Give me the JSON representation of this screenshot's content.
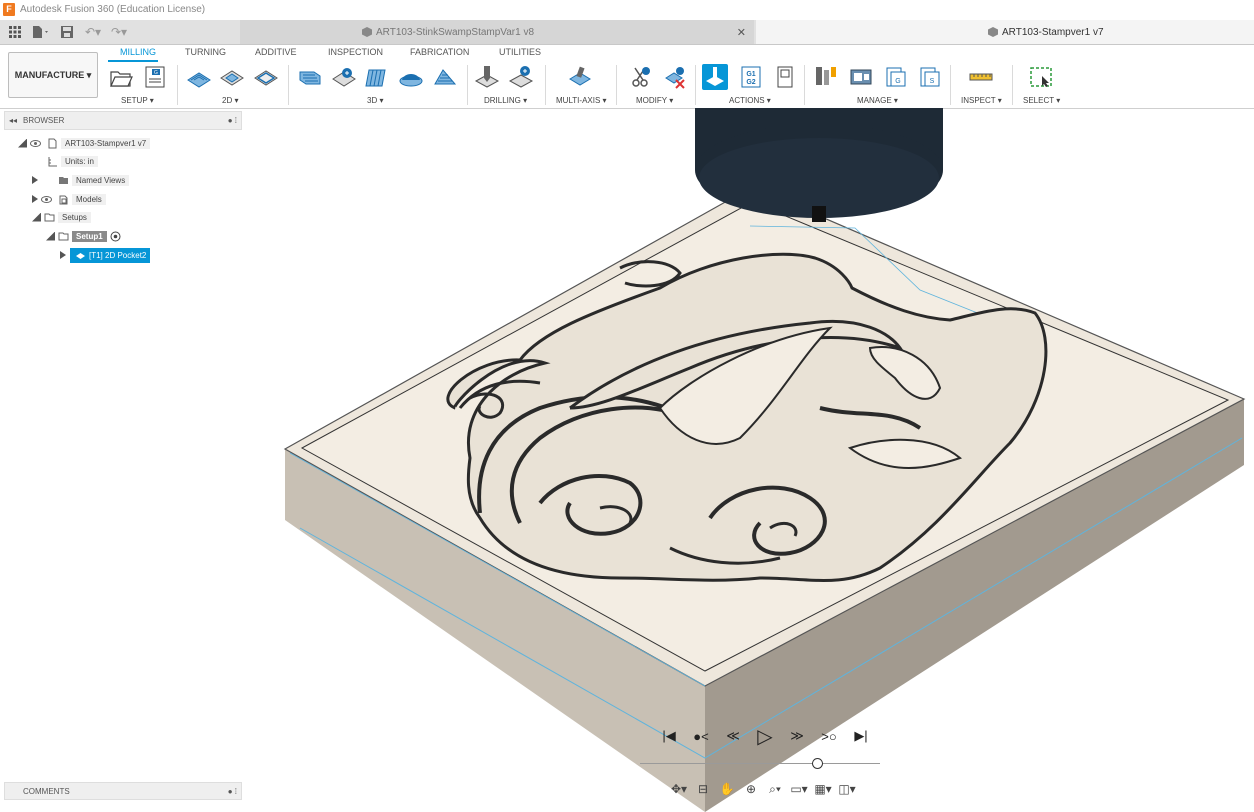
{
  "app": {
    "title": "Autodesk Fusion 360 (Education License)",
    "icon_letter": "F"
  },
  "doc_tabs": [
    {
      "label": "ART103-StinkSwampStampVar1 v8",
      "active": false
    },
    {
      "label": "ART103-Stampver1 v7",
      "active": true
    }
  ],
  "workspace": {
    "label": "MANUFACTURE ▾"
  },
  "ribbon_tabs": [
    "MILLING",
    "TURNING",
    "ADDITIVE",
    "INSPECTION",
    "FABRICATION",
    "UTILITIES"
  ],
  "ribbon_groups": [
    "SETUP ▾",
    "2D ▾",
    "3D ▾",
    "DRILLING ▾",
    "MULTI-AXIS ▾",
    "MODIFY ▾",
    "ACTIONS ▾",
    "MANAGE ▾",
    "INSPECT ▾",
    "SELECT ▾"
  ],
  "browser": {
    "title": "BROWSER",
    "root": "ART103-Stampver1 v7",
    "units": "Units: in",
    "named_views": "Named Views",
    "models": "Models",
    "setups": "Setups",
    "setup1": "Setup1",
    "operation": "[T1] 2D Pocket2"
  },
  "comments": {
    "label": "COMMENTS"
  },
  "actions_g1g2": [
    "G1",
    "G2"
  ],
  "colors": {
    "accent": "#0696d7",
    "stock_top": "#eee7dc",
    "stock_side": "#c4bbaf",
    "tool_body": "#1e2a36",
    "selected_row": "#0696d7"
  },
  "icons": {
    "playback": [
      "skip-to-start-icon",
      "previous-operation-icon",
      "step-back-icon",
      "play-icon",
      "step-forward-icon",
      "next-operation-icon",
      "skip-to-end-icon"
    ],
    "nav": [
      "orbit-icon",
      "look-at-icon",
      "pan-icon",
      "zoom-icon",
      "fit-icon",
      "display-settings-icon",
      "grid-settings-icon",
      "viewports-icon"
    ]
  }
}
